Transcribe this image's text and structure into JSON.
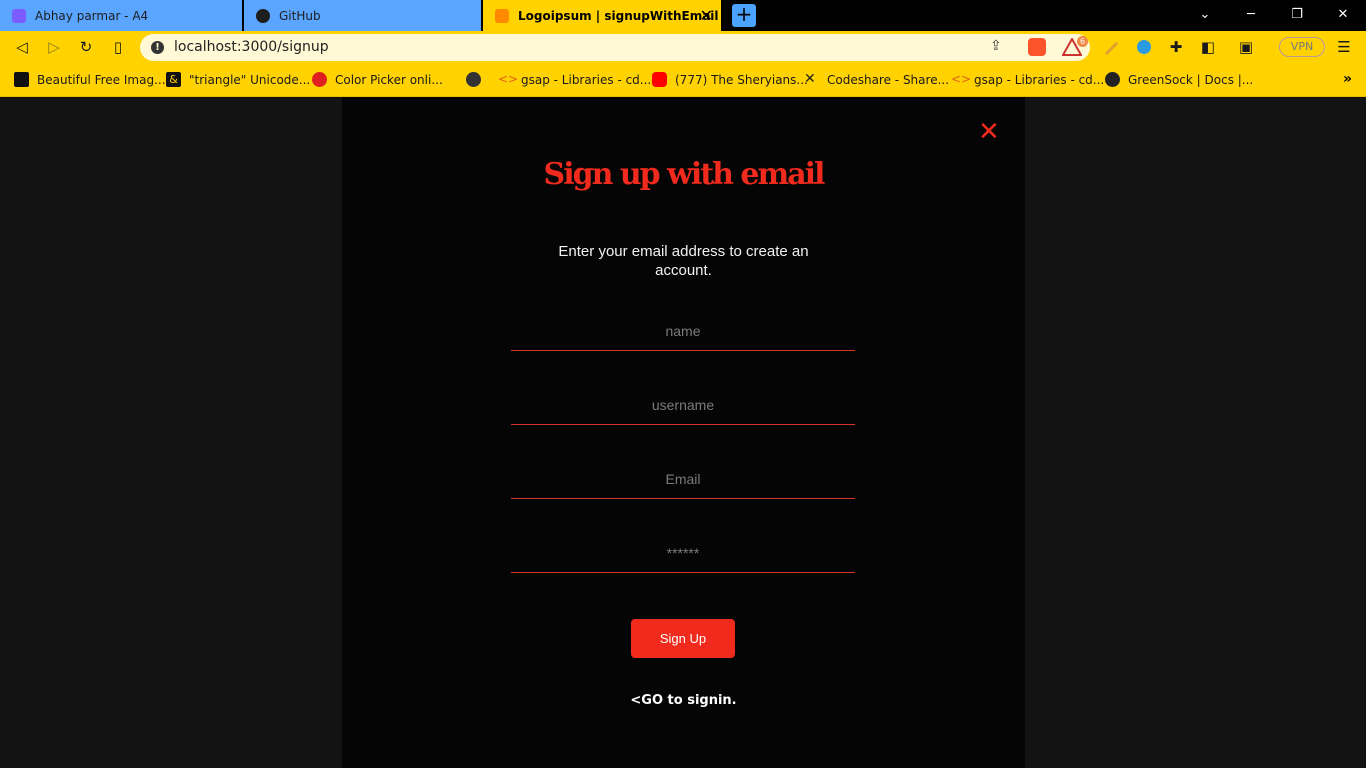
{
  "tabs": [
    {
      "label": "Abhay parmar - A4",
      "icon": "figma-icon"
    },
    {
      "label": "GitHub",
      "icon": "github-icon"
    },
    {
      "label": "Logoipsum | signupWithEmail",
      "icon": "blogger-icon",
      "active": true
    }
  ],
  "window": {
    "minimize": "─",
    "restore": "❐",
    "close": "✕",
    "tab_list": "⌄"
  },
  "toolbar": {
    "url": "localhost:3000/signup",
    "rewards_count": "6",
    "vpn_label": "VPN"
  },
  "bookmarks": [
    "Beautiful Free Imag...",
    "\"triangle\" Unicode...",
    "Color Picker onli...",
    "",
    "gsap - Libraries - cd...",
    "(777) The Sheryians...",
    "Codeshare - Share...",
    "gsap - Libraries - cd...",
    "GreenSock | Docs |..."
  ],
  "modal": {
    "title": "Sign up with email",
    "subtitle": "Enter your email address to create an account.",
    "fields": {
      "name_placeholder": "name",
      "username_placeholder": "username",
      "email_placeholder": "Email",
      "password_placeholder": "******"
    },
    "submit_label": "Sign Up",
    "signin_link": "<GO to signin.",
    "close_glyph": "✕"
  },
  "colors": {
    "accent": "#f02a1d",
    "chrome": "#ffd200",
    "tab_inactive": "#5aa5ff",
    "modal_bg": "#050505"
  }
}
